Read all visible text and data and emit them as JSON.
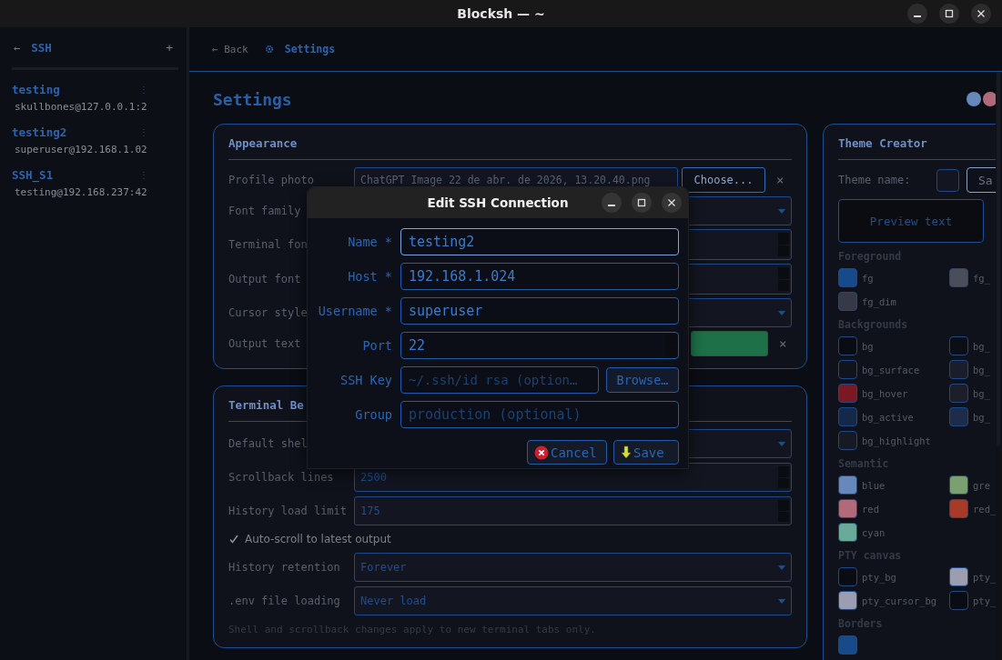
{
  "window": {
    "title": "Blocksh — ~"
  },
  "sidebar": {
    "back": "←",
    "title": "SSH",
    "add": "+",
    "connections": [
      {
        "name": "testing",
        "menu": "⋮",
        "address": "skullbones@127.0.0.1:2"
      },
      {
        "name": "testing2",
        "menu": "⋮",
        "address": "superuser@192.168.1.02"
      },
      {
        "name": "SSH_S1",
        "menu": "⋮",
        "address": "testing@192.168.237:42"
      }
    ]
  },
  "topbar": {
    "back": "← Back",
    "title": "Settings"
  },
  "page": {
    "heading": "Settings",
    "theme_dots": [
      {
        "color": "#6688bb"
      },
      {
        "color": "#b06a7a"
      }
    ]
  },
  "appearance": {
    "title": "Appearance",
    "rows": [
      {
        "label": "Profile photo",
        "kind": "file",
        "value": "ChatGPT Image 22 de abr. de 2026, 13.20.40.png",
        "button": "Choose...",
        "clear": "×"
      },
      {
        "label": "Font family",
        "kind": "select"
      },
      {
        "label": "Terminal fon",
        "kind": "number"
      },
      {
        "label": "Output font",
        "kind": "number"
      },
      {
        "label": "Cursor style",
        "kind": "select"
      },
      {
        "label": "Output text",
        "kind": "color",
        "color": "#1e7048",
        "clear": "×"
      }
    ]
  },
  "terminal": {
    "title": "Terminal Be",
    "rows": [
      {
        "label": "Default shel",
        "kind": "select"
      },
      {
        "label": "Scrollback lines",
        "kind": "number",
        "value": "2500"
      },
      {
        "label": "History load limit",
        "kind": "number",
        "value": "175"
      },
      {
        "label": "Auto-scroll to latest output",
        "kind": "checkbox",
        "checked": true
      },
      {
        "label": "History retention",
        "kind": "select",
        "value": "Forever"
      },
      {
        "label": ".env file loading",
        "kind": "select",
        "value": "Never load"
      }
    ],
    "note": "Shell and scrollback changes apply to new terminal tabs only."
  },
  "theme_creator": {
    "title": "Theme Creator",
    "name_label": "Theme name:",
    "save": "Sa",
    "preview": "Preview text",
    "groups": [
      {
        "title": "Foreground",
        "swatches": [
          {
            "label": "fg",
            "color": "#174a8a"
          },
          {
            "label": "fg_",
            "color": "#4a4e5a"
          },
          {
            "label": "fg_dim",
            "color": "#363a48"
          }
        ]
      },
      {
        "title": "Backgrounds",
        "swatches": [
          {
            "label": "bg",
            "color": "#0a0c14"
          },
          {
            "label": "bg_",
            "color": "#0c0e16"
          },
          {
            "label": "bg_surface",
            "color": "#11141c"
          },
          {
            "label": "bg_",
            "color": "#1a1e2a"
          },
          {
            "label": "bg_hover",
            "color": "#7a1824"
          },
          {
            "label": "bg_",
            "color": "#1c1e2a"
          },
          {
            "label": "bg_active",
            "color": "#14284a"
          },
          {
            "label": "bg_",
            "color": "#1e2c4c"
          },
          {
            "label": "bg_highlight",
            "color": "#151a24"
          }
        ]
      },
      {
        "title": "Semantic",
        "swatches": [
          {
            "label": "blue",
            "color": "#6688bb"
          },
          {
            "label": "gre",
            "color": "#7aa070"
          },
          {
            "label": "red",
            "color": "#b06a7a"
          },
          {
            "label": "red_",
            "color": "#a83a2a"
          },
          {
            "label": "cyan",
            "color": "#6aaa9a"
          }
        ]
      },
      {
        "title": "PTY canvas",
        "swatches": [
          {
            "label": "pty_bg",
            "color": "#0a0c14"
          },
          {
            "label": "pty_",
            "color": "#9a9eb0"
          },
          {
            "label": "pty_cursor_bg",
            "color": "#9a9eb0"
          },
          {
            "label": "pty_",
            "color": "#0a0c14"
          }
        ]
      },
      {
        "title": "Borders",
        "swatches": [
          {
            "color": "#174a8a"
          }
        ]
      }
    ]
  },
  "modal": {
    "title": "Edit SSH Connection",
    "fields": [
      {
        "label": "Name *",
        "kind": "text",
        "value": "testing2",
        "focused": true
      },
      {
        "label": "Host *",
        "kind": "text",
        "value": "192.168.1.024",
        "focused": false
      },
      {
        "label": "Username *",
        "kind": "text",
        "value": "superuser",
        "focused": false
      },
      {
        "label": "Port",
        "kind": "number",
        "value": "22",
        "focused": false
      },
      {
        "label": "SSH Key",
        "kind": "file",
        "placeholder": "~/.ssh/id_rsa (option…",
        "button": "Browse…",
        "focused": false
      },
      {
        "label": "Group",
        "kind": "text",
        "placeholder": "production (optional)",
        "focused": false
      }
    ],
    "buttons": [
      {
        "label": "Cancel",
        "kind": "cancel"
      },
      {
        "label": "Save",
        "kind": "save"
      }
    ]
  }
}
